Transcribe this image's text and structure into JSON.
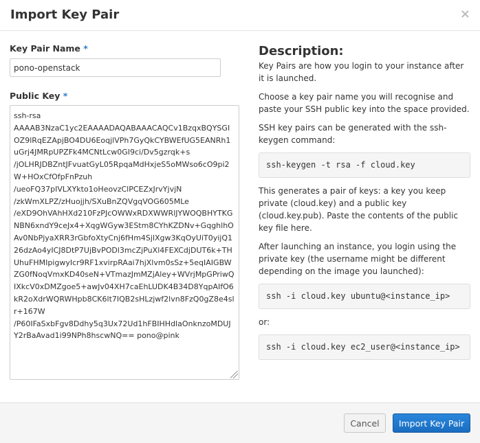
{
  "dialog": {
    "title": "Import Key Pair",
    "close_symbol": "×"
  },
  "form": {
    "name_label": "Key Pair Name",
    "name_required": "*",
    "name_value": "pono-openstack",
    "key_label": "Public Key",
    "key_required": "*",
    "key_value": "ssh-rsa\nAAAAB3NzaC1yc2EAAAADAQABAAACAQCv1BzqxBQYSGIOZ9lRqEZApjBO4DU6EoqjlVPh7GyQkCYBWEfUG5EANRh1uGrj4JMRpUPZFk4MCNtLcw0GI9ci/Dv5gzrqk+s\n/jOLHRJDBZntJFvuatGyL05RpqaMdHxjeS5oMWso6cO9pi2W+HOxCfOfpFnPzuh\n/ueoFQ37pIVLXYkto1oHeovzClPCEZxJrvYjvjN\n/zkWmXLPZ/zHuojjh/SXuBnZQVgqVOG605MLe\n/eXD9OhVAhHXd210FzPJcOWWxRDXWWRlJYWOQBHYTKGNBN6xndY9ceJx4+XqgWGyw3EStm8CYhKZDNv+GqghlhOAv0NbPjyaXRR3rGbfoXtyCnj6fHm4SjlXgw3KqOyUiT0yijQ126dzAo4yICJ8DtP7UjBvPODl3mcZjPuXl4FEXCdjDUT6k+THUhuFHMIpigwyIcr9RF1xvirpRAai7hjXlvm0sSz+5eqIAIGBWZG0fNoqVmxKD40seN+VTmazJmMZjAley+WVrjMpGPriwQIXkcV0xDMZgoe5+awJv04XH7caEhLUDK4B34D8YqpAIfO6kR2oXdrWQRWHpb8CK6lt7IQB2sHLzjwf2lvn8FzQ0gZ8e4slr+167W\n/P60IFaSxbFgv8Ddhy5q3Ux72Ud1hFBIHHdlaOnknzoMDUJY2rBaAvad1i99NPh8hscwNQ== pono@pink"
  },
  "description": {
    "heading": "Description:",
    "p1": "Key Pairs are how you login to your instance after it is launched.",
    "p2": "Choose a key pair name you will recognise and paste your SSH public key into the space provided.",
    "p3": "SSH key pairs can be generated with the ssh-keygen command:",
    "code1": "ssh-keygen -t rsa -f cloud.key",
    "p4": "This generates a pair of keys: a key you keep private (cloud.key) and a public key (cloud.key.pub). Paste the contents of the public key file here.",
    "p5": "After launching an instance, you login using the private key (the username might be different depending on the image you launched):",
    "code2": "ssh -i cloud.key ubuntu@<instance_ip>",
    "or": "or:",
    "code3": "ssh -i cloud.key ec2_user@<instance_ip>"
  },
  "footer": {
    "cancel_label": "Cancel",
    "submit_label": "Import Key Pair"
  },
  "colors": {
    "primary": "#1b75cf",
    "required": "#2b7bc6"
  }
}
